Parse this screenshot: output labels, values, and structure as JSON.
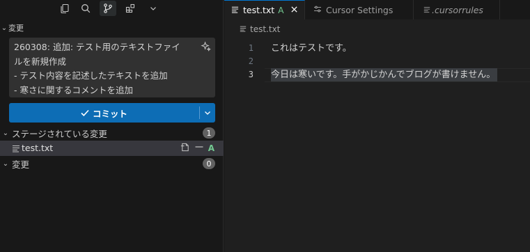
{
  "activity_bar": {
    "icons": [
      "copy-icon",
      "search-icon",
      "source-control-icon",
      "extensions-icon",
      "chevron-down-icon"
    ]
  },
  "scm": {
    "section_title": "変更",
    "commit_message_lines": [
      "260308: 追加: テスト用のテキストファイ",
      "ルを新規作成",
      "- テスト内容を記述したテキストを追加",
      "- 寒さに関するコメントを追加"
    ],
    "commit_button_label": "コミット",
    "staged": {
      "label": "ステージされている変更",
      "count": "1",
      "files": [
        {
          "name": "test.txt",
          "status": "A"
        }
      ]
    },
    "changes": {
      "label": "変更",
      "count": "0"
    }
  },
  "editor": {
    "tabs": [
      {
        "label": "test.txt",
        "badge": "A",
        "active": true,
        "icon": "file-lines-icon"
      },
      {
        "label": "Cursor Settings",
        "active": false,
        "icon": "settings-sliders-icon"
      },
      {
        "label": ".cursorrules",
        "active": false,
        "icon": "file-lines-icon"
      }
    ],
    "breadcrumb": "test.txt",
    "lines": [
      {
        "number": "1",
        "text": "これはテストです。"
      },
      {
        "number": "2",
        "text": ""
      },
      {
        "number": "3",
        "text": "今日は寒いです。手がかじかんでブログが書けません。"
      }
    ]
  },
  "colors": {
    "accent": "#0d6db5",
    "added": "#73c991",
    "active_tab_border": "#0078d4"
  }
}
